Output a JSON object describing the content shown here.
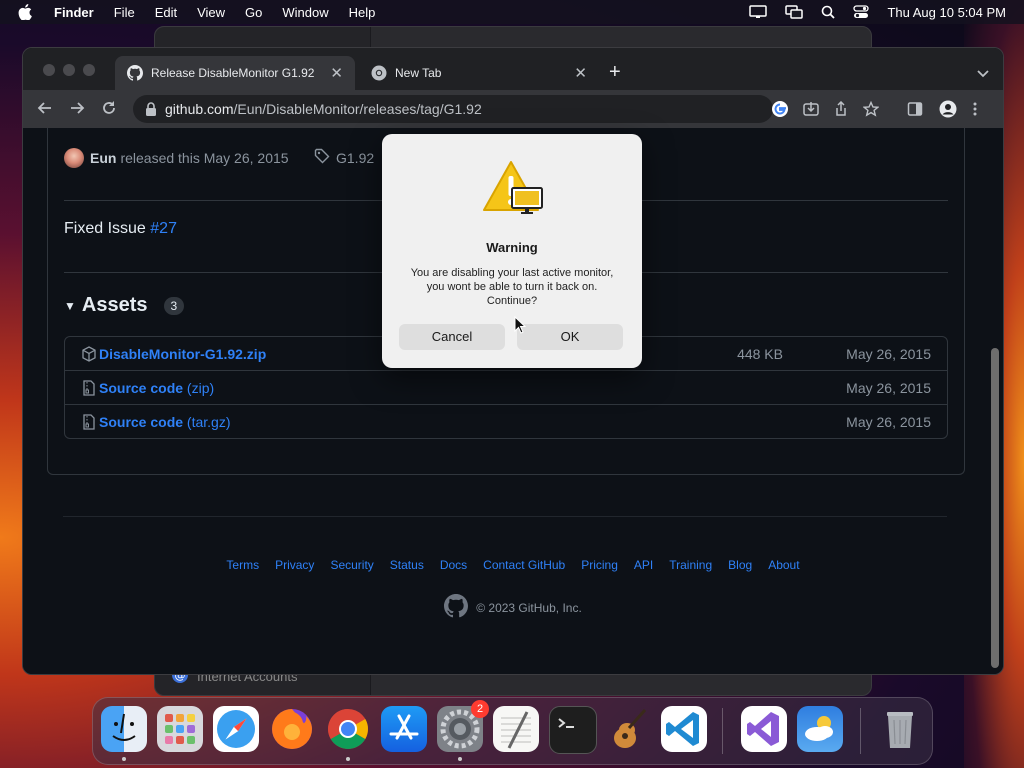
{
  "menubar": {
    "app": "Finder",
    "items": [
      "File",
      "Edit",
      "View",
      "Go",
      "Window",
      "Help"
    ],
    "clock": "Thu Aug 10  5:04 PM"
  },
  "background_window": {
    "footer_item": "Internet Accounts"
  },
  "browser": {
    "tabs": [
      {
        "title": "Release DisableMonitor G1.92",
        "icon": "github-icon",
        "active": true
      },
      {
        "title": "New Tab",
        "icon": "chrome-icon",
        "active": false
      }
    ],
    "url_domain": "github.com",
    "url_path": "/Eun/DisableMonitor/releases/tag/G1.92"
  },
  "release": {
    "author": "Eun",
    "released_text": "released this May 26, 2015",
    "tag": "G1.92",
    "body_prefix": "Fixed Issue ",
    "issue_link": "#27",
    "assets_title": "Assets",
    "assets_count": "3",
    "assets": [
      {
        "name": "DisableMonitor-G1.92.zip",
        "suffix": "",
        "size": "448 KB",
        "date": "May 26, 2015",
        "icon": "package-icon"
      },
      {
        "name": "Source code",
        "suffix": " (zip)",
        "size": "",
        "date": "May 26, 2015",
        "icon": "file-zip-icon"
      },
      {
        "name": "Source code",
        "suffix": " (tar.gz)",
        "size": "",
        "date": "May 26, 2015",
        "icon": "file-zip-icon"
      }
    ]
  },
  "footer": {
    "links": [
      "Terms",
      "Privacy",
      "Security",
      "Status",
      "Docs",
      "Contact GitHub",
      "Pricing",
      "API",
      "Training",
      "Blog",
      "About"
    ],
    "copyright": "© 2023 GitHub, Inc."
  },
  "dialog": {
    "title": "Warning",
    "message": "You are disabling your last active monitor, you wont be able to turn it back on. Continue?",
    "cancel_label": "Cancel",
    "ok_label": "OK"
  },
  "dock": {
    "apps": [
      "Finder",
      "Launchpad",
      "Safari",
      "Firefox",
      "Chrome",
      "App Store",
      "System Settings",
      "TextEdit",
      "Terminal",
      "GarageBand",
      "VS Code",
      "Visual Studio",
      "Weather",
      "Trash"
    ],
    "settings_badge": "2",
    "colors": {
      "accent_blue": "#2f81f7",
      "badge_red": "#ff3b30"
    }
  }
}
